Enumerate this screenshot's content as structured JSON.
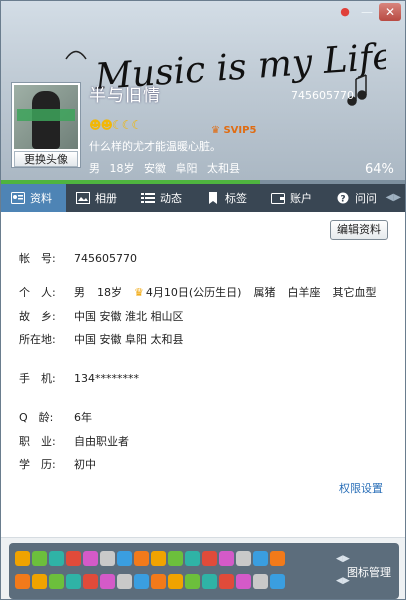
{
  "window": {
    "skin_icon": "skin-icon",
    "minimize_icon": "minimize-icon",
    "close_icon": "close-icon"
  },
  "header": {
    "nickname": "半与旧情",
    "qq_number": "745605770",
    "signature": "什么样的尤才能温暖心脏。",
    "brief": "男 18岁 安徽 阜阳 太和县",
    "percent": "64%",
    "progress": 0.64,
    "vip": "SVIP5",
    "avatar_button": "更换头像",
    "avatar_badge": "",
    "decoration_text": "Music is my Life"
  },
  "tabs": [
    {
      "label": "资料",
      "icon": "profile-card-icon"
    },
    {
      "label": "相册",
      "icon": "photo-icon"
    },
    {
      "label": "动态",
      "icon": "feed-icon"
    },
    {
      "label": "标签",
      "icon": "tag-icon"
    },
    {
      "label": "账户",
      "icon": "wallet-icon"
    },
    {
      "label": "问问",
      "icon": "question-icon"
    }
  ],
  "content": {
    "edit_button": "编辑资料",
    "account": {
      "label": "帐　号:",
      "value": "745605770"
    },
    "personal": {
      "label": "个　人:",
      "gender": "男",
      "age": "18岁",
      "birthday": "4月10日(公历生日)",
      "zodiac": "属猪",
      "constellation": "白羊座",
      "blood": "其它血型"
    },
    "hometown": {
      "label": "故　乡:",
      "value": "中国 安徽 淮北 相山区"
    },
    "location": {
      "label": "所在地:",
      "value": "中国 安徽 阜阳 太和县"
    },
    "mobile": {
      "label": "手　机:",
      "value": "134********"
    },
    "qage": {
      "label": "Q　龄:",
      "value": "6年"
    },
    "job": {
      "label": "职　业:",
      "value": "自由职业者"
    },
    "education": {
      "label": "学　历:",
      "value": "初中"
    },
    "permission_link": "权限设置"
  },
  "bottom": {
    "manage_label": "图标管理"
  },
  "colors": {
    "header": "#b8c4cf",
    "tabbar": "#394653",
    "tab_active": "#4e84b5",
    "link": "#2a6fb8",
    "progress": "#4fb43f"
  }
}
